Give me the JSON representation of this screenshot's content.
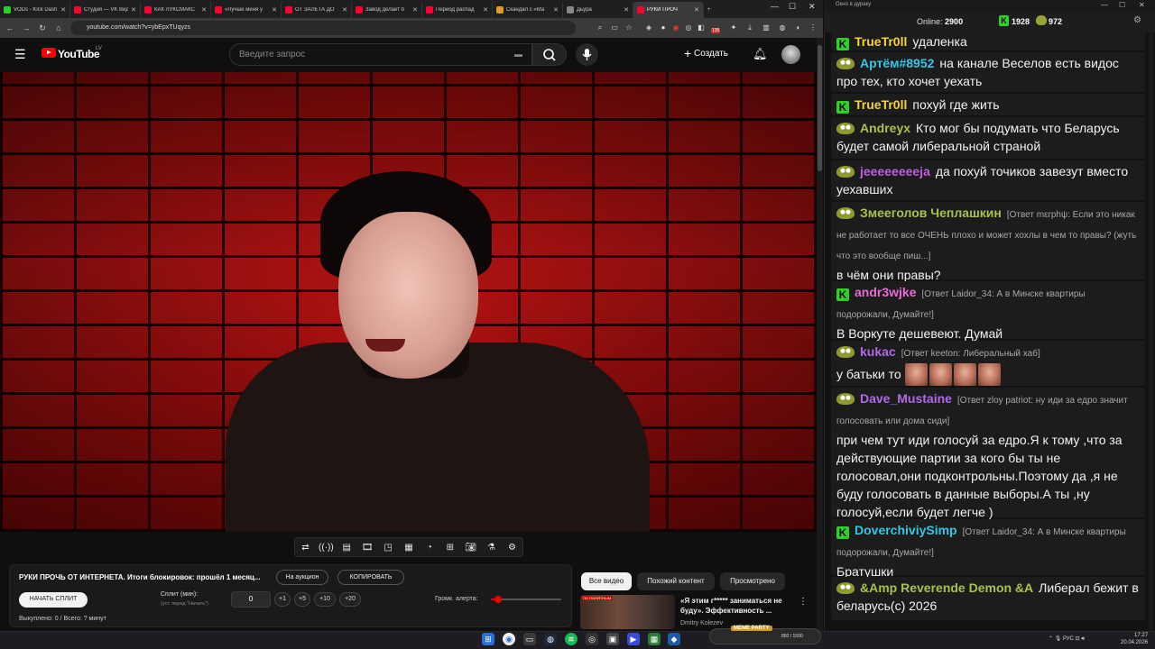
{
  "browser": {
    "tabs": [
      {
        "label": "VODs - Kick Dash",
        "color": "#2fd02a"
      },
      {
        "label": "Студия — VK Видео",
        "color": "#ff0033"
      },
      {
        "label": "КАК ЛУКСМАКС",
        "color": "#ff0033"
      },
      {
        "label": "«Лучше меня у",
        "color": "#ff0033"
      },
      {
        "label": "ОТ ЗАЛЕТА ДО",
        "color": "#ff0033"
      },
      {
        "label": "Завод делает б",
        "color": "#ff0033"
      },
      {
        "label": "Период распад",
        "color": "#ff0033"
      },
      {
        "label": "Скандал с «Ма",
        "color": "#e09a2a"
      },
      {
        "label": "Дьӱра",
        "color": "#888888"
      },
      {
        "label": "РУКИ ПРОЧ",
        "color": "#ff0033"
      }
    ],
    "url": "youtube.com/watch?v=ybEpxTUqyzs",
    "ext_badge": "135"
  },
  "youtube": {
    "logo_text": "YouTube",
    "region": "LV",
    "search_placeholder": "Введите запрос",
    "create_label": "Создать",
    "filter_chips": [
      "Все видео",
      "Похожий контент",
      "Просмотрено"
    ],
    "related": {
      "thumb_tag": "ПО ПОНЯТНЫМ",
      "title": "«Я этим г***** заниматься не буду». Эффективность ...",
      "channel": "Dmitry Kolezev"
    }
  },
  "plugin": {
    "title": "РУКИ ПРОЧЬ ОТ ИНТЕРНЕТА. Итоги блокировок: прошёл 1 месяц...",
    "auction_label": "На аукцион",
    "copy_label": "КОПИРОВАТЬ",
    "start_split_label": "НАЧАТЬ СПЛИТ",
    "split_label": "Сплит (мин):",
    "split_hint": "(уст. перед \"Начать\")",
    "split_value": "0",
    "increments": [
      "+1",
      "+5",
      "+10",
      "+20"
    ],
    "volume_label": "Громк. алерта:",
    "volume_level": 0.1,
    "bought_text": "Выкуплено: 0 / Всего: ? минут"
  },
  "chat": {
    "window_title": "Окно в дураку",
    "online_label": "Online:",
    "online_count": "2900",
    "kick_count": "1928",
    "frog_count": "972",
    "messages": [
      {
        "badge": "kick",
        "user": "TrueTr0ll",
        "color": "#f2d236",
        "reply": "",
        "text": "удаленка"
      },
      {
        "badge": "frog",
        "user": "Артём#8952",
        "color": "#35c6e6",
        "reply": "",
        "text": "на канале Веселов есть видос про тех, кто хочет уехать"
      },
      {
        "badge": "kick",
        "user": "TrueTr0ll",
        "color": "#f2d236",
        "reply": "",
        "text": "похуй где жить"
      },
      {
        "badge": "frog",
        "user": "Andreyx",
        "color": "#a8c24a",
        "reply": "",
        "text": "Кто мог бы подумать что Беларусь будет самой либеральной страной"
      },
      {
        "badge": "frog",
        "user": "jeeeeeeeeja",
        "color": "#c05de0",
        "reply": "",
        "text": "да похуй точиков завезут вместо уехавших"
      },
      {
        "badge": "frog",
        "user": "Змееголов Чеплашкин",
        "color": "#a8c24a",
        "reply": "[Ответ mεrphψ: Если это никак не работает то все ОЧЕНЬ плохо и может хохлы в чем то правы? (жуть что это вообще пиш...]",
        "text": "в чём они правы?"
      },
      {
        "badge": "kick",
        "user": "andr3wjke",
        "color": "#e96ad8",
        "reply": "[Ответ Laidor_34: А в Минске квартиры подорожали, Думайте!]",
        "text": "В Воркуте дешевеют. Думай"
      },
      {
        "badge": "frog",
        "user": "kukac",
        "color": "#b06ae8",
        "reply": "[Ответ keeton: Либеральный хаб]",
        "text": "у батьки то"
      },
      {
        "badge": "frog",
        "user": "Dave_Mustaine",
        "color": "#b06ae8",
        "reply": "[Ответ zloy patriot: ну иди за едро значит голосовать или дома сиди]",
        "text": "при чем тут иди голосуй за едро.Я к тому ,что за действующие партии за кого бы ты не голосовал,они подконтрольны.Поэтому да ,я не буду голосовать в данные выборы.А ты ,ну голосуй,если будет легче )"
      },
      {
        "badge": "kick",
        "user": "DoverchiviySimp",
        "color": "#35c6e6",
        "reply": "[Ответ Laidor_34: А в Минске квартиры подорожали, Думайте!]",
        "text": "Братушки"
      },
      {
        "badge": "frog",
        "user": "&Amp Reverende Demon &A",
        "color": "#a8c24a",
        "reply": "",
        "text": "Либерал бежит в беларусь(с) 2026"
      }
    ]
  },
  "taskbar": {
    "widget_title": "MEME PARTY",
    "widget_count": "850 / 1500",
    "lang": "РУС",
    "time": "17:27",
    "date": "20.04.2026"
  }
}
